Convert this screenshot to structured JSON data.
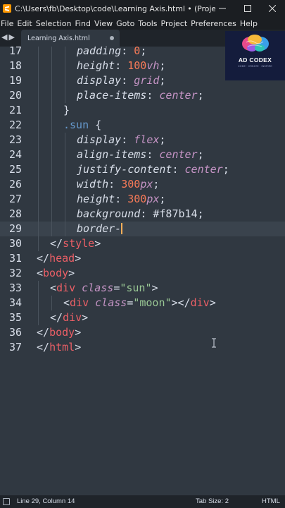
{
  "window": {
    "title": "C:\\Users\\fb\\Desktop\\code\\Learning Axis.html • (Project) - Su...",
    "minimize_icon": "minimize-icon",
    "maximize_icon": "maximize-icon",
    "close_icon": "close-icon"
  },
  "menu": [
    "File",
    "Edit",
    "Selection",
    "Find",
    "View",
    "Goto",
    "Tools",
    "Project",
    "Preferences",
    "Help"
  ],
  "tabs": [
    {
      "label": "Learning Axis.html",
      "modified": true
    }
  ],
  "logo": {
    "text": "AD CODEX",
    "tagline": "CODE · CREATE · INSPIRE"
  },
  "editor": {
    "current_line": 29,
    "lines": [
      {
        "n": "17",
        "indent": 3,
        "tokens": [
          [
            "prop",
            "padding"
          ],
          [
            "punc",
            ": "
          ],
          [
            "num",
            "0"
          ],
          [
            "punc",
            ";"
          ]
        ]
      },
      {
        "n": "18",
        "indent": 3,
        "tokens": [
          [
            "prop",
            "height"
          ],
          [
            "punc",
            ": "
          ],
          [
            "num",
            "100"
          ],
          [
            "unit",
            "vh"
          ],
          [
            "punc",
            ";"
          ]
        ]
      },
      {
        "n": "19",
        "indent": 3,
        "tokens": [
          [
            "prop",
            "display"
          ],
          [
            "punc",
            ": "
          ],
          [
            "kw",
            "grid"
          ],
          [
            "punc",
            ";"
          ]
        ]
      },
      {
        "n": "20",
        "indent": 3,
        "tokens": [
          [
            "prop",
            "place-items"
          ],
          [
            "punc",
            ": "
          ],
          [
            "kw",
            "center"
          ],
          [
            "punc",
            ";"
          ]
        ]
      },
      {
        "n": "21",
        "indent": 2,
        "tokens": [
          [
            "punc",
            "}"
          ]
        ]
      },
      {
        "n": "22",
        "indent": 2,
        "tokens": [
          [
            "sel",
            ".sun"
          ],
          [
            "punc",
            " {"
          ]
        ]
      },
      {
        "n": "23",
        "indent": 3,
        "tokens": [
          [
            "prop",
            "display"
          ],
          [
            "punc",
            ": "
          ],
          [
            "kw",
            "flex"
          ],
          [
            "punc",
            ";"
          ]
        ]
      },
      {
        "n": "24",
        "indent": 3,
        "tokens": [
          [
            "prop",
            "align-items"
          ],
          [
            "punc",
            ": "
          ],
          [
            "kw",
            "center"
          ],
          [
            "punc",
            ";"
          ]
        ]
      },
      {
        "n": "25",
        "indent": 3,
        "tokens": [
          [
            "prop",
            "justify-content"
          ],
          [
            "punc",
            ": "
          ],
          [
            "kw",
            "center"
          ],
          [
            "punc",
            ";"
          ]
        ]
      },
      {
        "n": "26",
        "indent": 3,
        "tokens": [
          [
            "prop",
            "width"
          ],
          [
            "punc",
            ": "
          ],
          [
            "num",
            "300"
          ],
          [
            "unit",
            "px"
          ],
          [
            "punc",
            ";"
          ]
        ]
      },
      {
        "n": "27",
        "indent": 3,
        "tokens": [
          [
            "prop",
            "height"
          ],
          [
            "punc",
            ": "
          ],
          [
            "num",
            "300"
          ],
          [
            "unit",
            "px"
          ],
          [
            "punc",
            ";"
          ]
        ]
      },
      {
        "n": "28",
        "indent": 3,
        "tokens": [
          [
            "prop",
            "background"
          ],
          [
            "punc",
            ": "
          ],
          [
            "plain",
            "#f87b14"
          ],
          [
            "punc",
            ";"
          ]
        ]
      },
      {
        "n": "29",
        "indent": 3,
        "tokens": [
          [
            "prop",
            "border-"
          ]
        ],
        "caret": true
      },
      {
        "n": "30",
        "indent": 1,
        "tokens": [
          [
            "punc",
            "</"
          ],
          [
            "tag",
            "style"
          ],
          [
            "punc",
            ">"
          ]
        ]
      },
      {
        "n": "31",
        "indent": 0,
        "tokens": [
          [
            "punc",
            "</"
          ],
          [
            "tag",
            "head"
          ],
          [
            "punc",
            ">"
          ]
        ]
      },
      {
        "n": "32",
        "indent": 0,
        "tokens": [
          [
            "punc",
            "<"
          ],
          [
            "tag",
            "body"
          ],
          [
            "punc",
            ">"
          ]
        ]
      },
      {
        "n": "33",
        "indent": 1,
        "tokens": [
          [
            "punc",
            "<"
          ],
          [
            "tag",
            "div"
          ],
          [
            "punc",
            " "
          ],
          [
            "attr",
            "class"
          ],
          [
            "punc",
            "="
          ],
          [
            "str",
            "\"sun\""
          ],
          [
            "punc",
            ">"
          ]
        ]
      },
      {
        "n": "34",
        "indent": 2,
        "tokens": [
          [
            "punc",
            "<"
          ],
          [
            "tag",
            "div"
          ],
          [
            "punc",
            " "
          ],
          [
            "attr",
            "class"
          ],
          [
            "punc",
            "="
          ],
          [
            "str",
            "\"moon\""
          ],
          [
            "punc",
            "></"
          ],
          [
            "tag",
            "div"
          ],
          [
            "punc",
            ">"
          ]
        ]
      },
      {
        "n": "35",
        "indent": 1,
        "tokens": [
          [
            "punc",
            "</"
          ],
          [
            "tag",
            "div"
          ],
          [
            "punc",
            ">"
          ]
        ]
      },
      {
        "n": "36",
        "indent": 0,
        "tokens": [
          [
            "punc",
            "</"
          ],
          [
            "tag",
            "body"
          ],
          [
            "punc",
            ">"
          ]
        ]
      },
      {
        "n": "37",
        "indent": 0,
        "tokens": [
          [
            "punc",
            "</"
          ],
          [
            "tag",
            "html"
          ],
          [
            "punc",
            ">"
          ]
        ]
      }
    ]
  },
  "status": {
    "position": "Line 29, Column 14",
    "tab_size": "Tab Size: 2",
    "syntax": "HTML"
  },
  "colors": {
    "background": "#303841",
    "current_line": "#3a434d",
    "caret": "#f9ae58"
  }
}
